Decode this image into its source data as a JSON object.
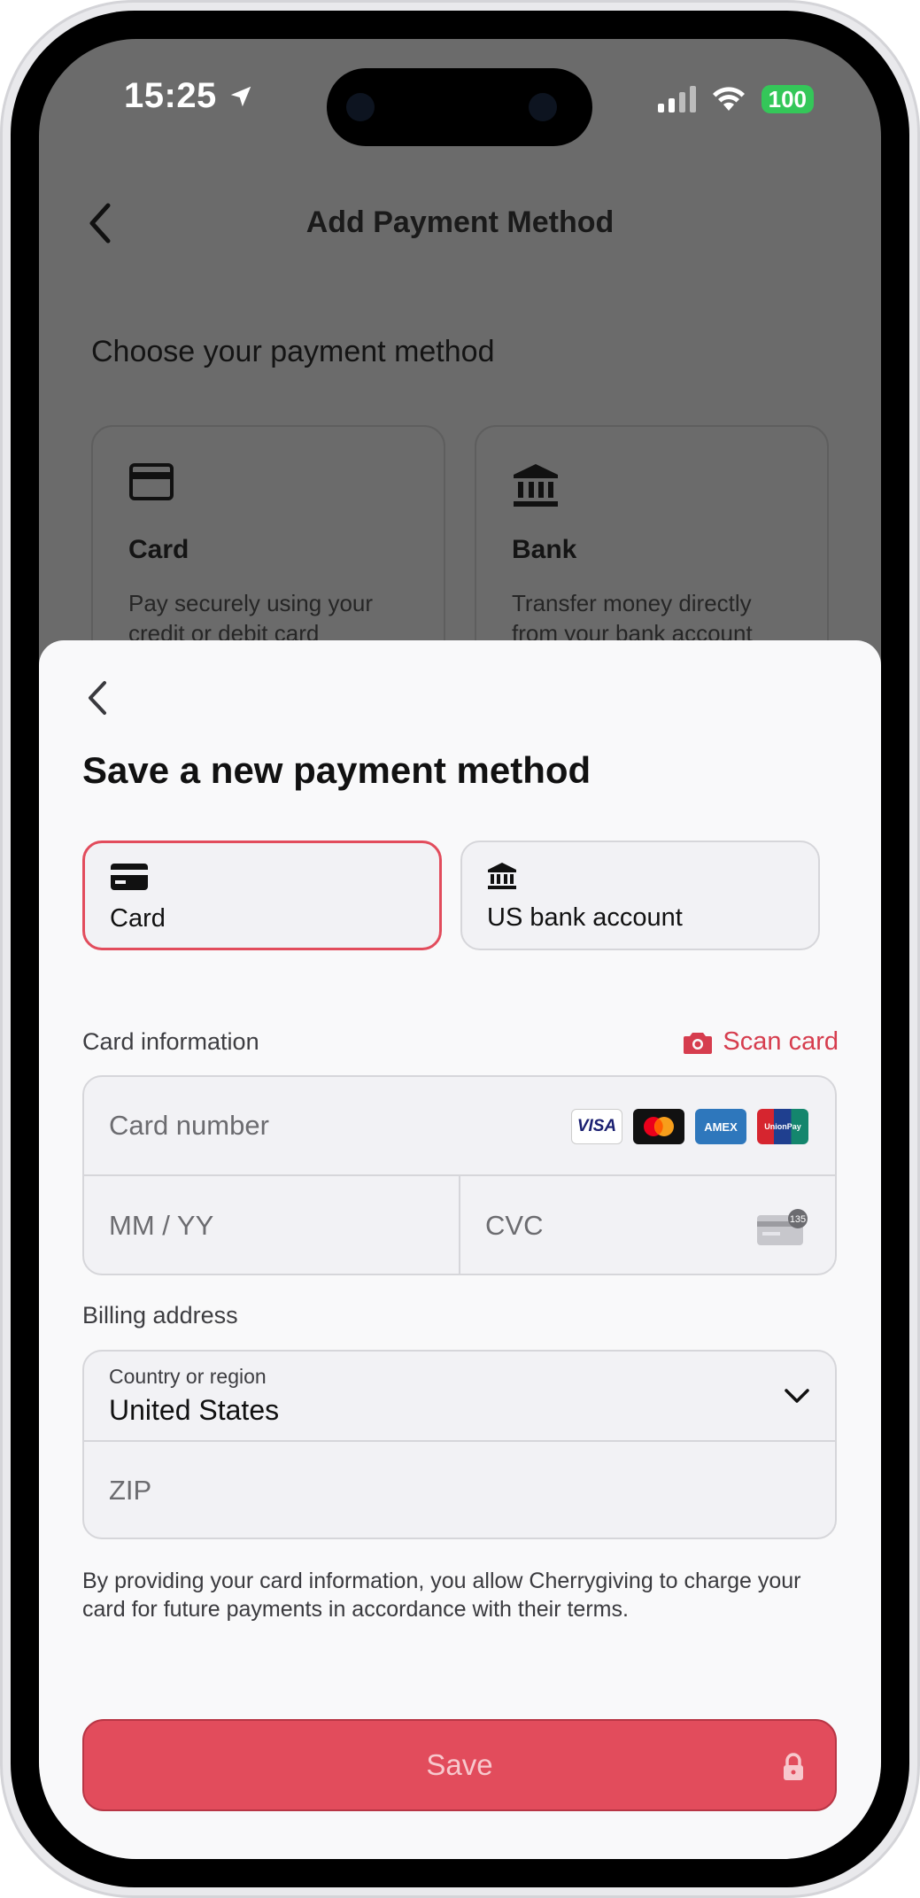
{
  "status_bar": {
    "time": "15:25",
    "battery": "100"
  },
  "background": {
    "title": "Add Payment Method",
    "subtitle": "Choose your payment method",
    "options": [
      {
        "name": "Card",
        "description": "Pay securely using your credit or debit card"
      },
      {
        "name": "Bank",
        "description": "Transfer money directly from your bank account"
      }
    ]
  },
  "sheet": {
    "title": "Save a new payment method",
    "tabs": [
      {
        "label": "Card",
        "icon": "credit-card-icon"
      },
      {
        "label": "US bank account",
        "icon": "bank-icon"
      }
    ],
    "card_info_label": "Card information",
    "scan_card_label": "Scan card",
    "card_number_placeholder": "Card number",
    "card_brands": [
      "VISA",
      "Mastercard",
      "AMEX",
      "UnionPay"
    ],
    "expiry_placeholder": "MM / YY",
    "cvc_placeholder": "CVC",
    "cvc_badge": "135",
    "billing_label": "Billing address",
    "country_label": "Country or region",
    "country_value": "United States",
    "zip_placeholder": "ZIP",
    "legal_text": "By providing your card information, you allow Cherrygiving to charge your card for future payments in accordance with their terms.",
    "save_label": "Save"
  },
  "colors": {
    "accent": "#e24c5c",
    "scan_text": "#d63d4e",
    "overlay": "#6b6b6b"
  }
}
